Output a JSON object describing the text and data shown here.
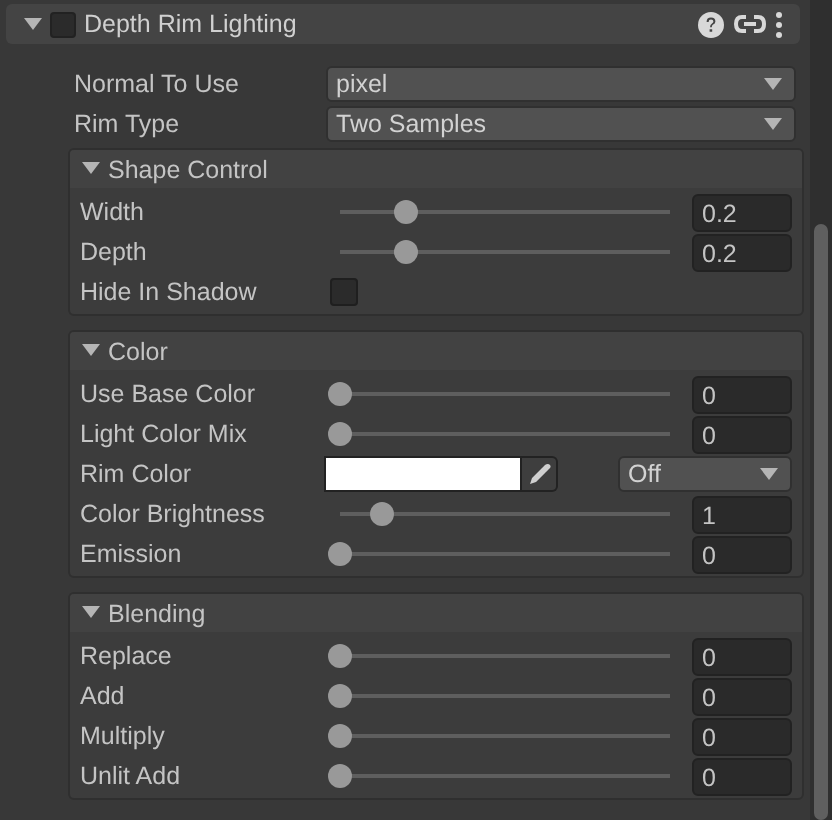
{
  "component": {
    "title": "Depth Rim Lighting",
    "expanded": true,
    "enabled": false
  },
  "properties": [
    {
      "kind": "dropdown",
      "label": "Normal To Use",
      "value": "pixel"
    },
    {
      "kind": "dropdown",
      "label": "Rim Type",
      "value": "Two Samples"
    }
  ],
  "groups": [
    {
      "title": "Shape Control",
      "expanded": true,
      "rows": [
        {
          "kind": "slider",
          "label": "Width",
          "level": 0.2,
          "value": "0.2"
        },
        {
          "kind": "slider",
          "label": "Depth",
          "level": 0.2,
          "value": "0.2"
        },
        {
          "kind": "checkbox",
          "label": "Hide In Shadow",
          "checked": false
        }
      ]
    },
    {
      "title": "Color",
      "expanded": true,
      "rows": [
        {
          "kind": "slider",
          "label": "Use Base Color",
          "level": 0,
          "value": "0"
        },
        {
          "kind": "slider",
          "label": "Light Color Mix",
          "level": 0,
          "value": "0"
        },
        {
          "kind": "color",
          "label": "Rim Color",
          "color": "#ffffff",
          "mode": "Off"
        },
        {
          "kind": "slider",
          "label": "Color Brightness",
          "level": 0.125,
          "value": "1"
        },
        {
          "kind": "slider",
          "label": "Emission",
          "level": 0,
          "value": "0"
        }
      ]
    },
    {
      "title": "Blending",
      "expanded": true,
      "rows": [
        {
          "kind": "slider",
          "label": "Replace",
          "level": 0,
          "value": "0"
        },
        {
          "kind": "slider",
          "label": "Add",
          "level": 0,
          "value": "0"
        },
        {
          "kind": "slider",
          "label": "Multiply",
          "level": 0,
          "value": "0"
        },
        {
          "kind": "slider",
          "label": "Unlit Add",
          "level": 0,
          "value": "0"
        }
      ]
    }
  ]
}
